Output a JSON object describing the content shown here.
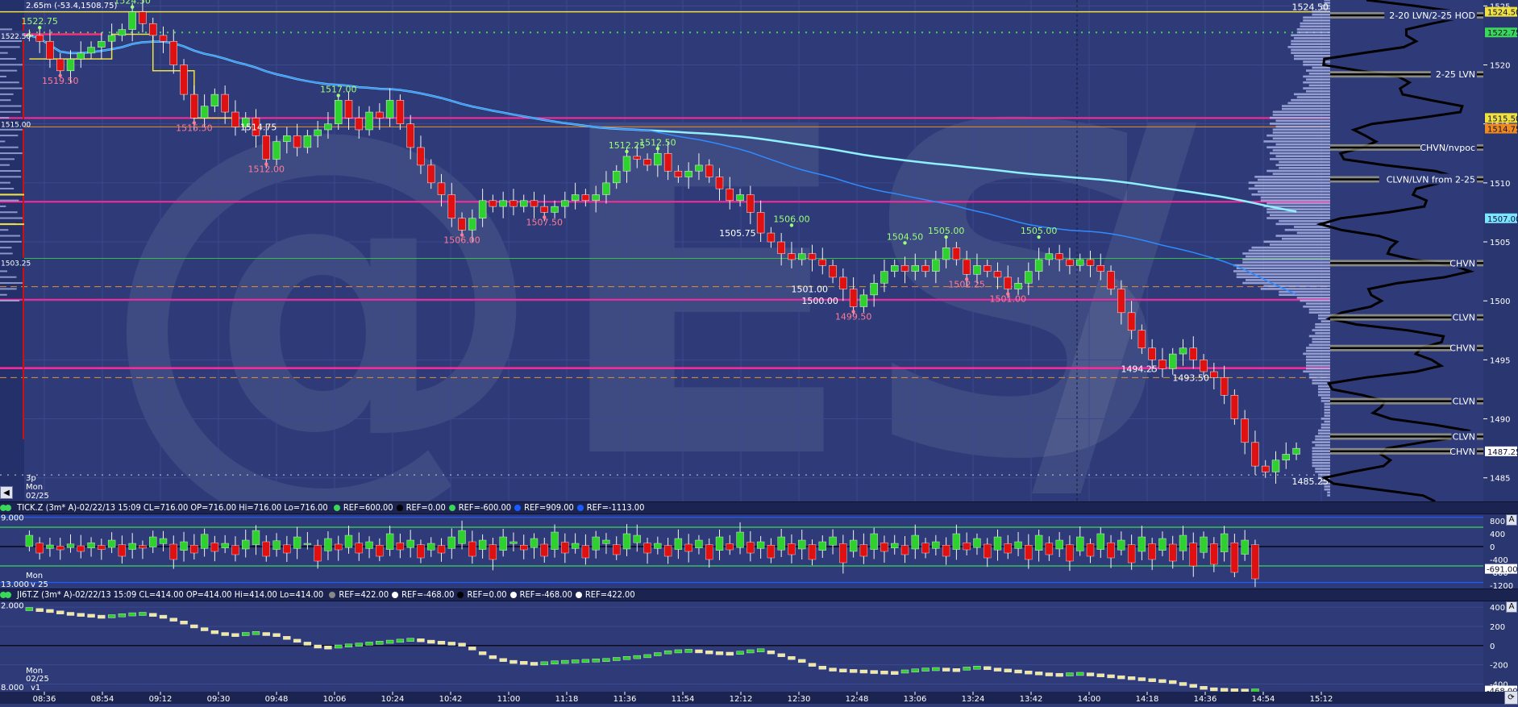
{
  "chart_data": [
    {
      "type": "candlestick",
      "symbol_watermark": "@ES",
      "header_text": "2.65m (-53.4,1508.75)",
      "ylim": [
        1483,
        1525.5
      ],
      "y_ticks": [
        "1525",
        "1520",
        "1515",
        "1510",
        "1505",
        "1500",
        "1495",
        "1490",
        "1485"
      ],
      "x_ticks": [
        "08:36",
        "08:54",
        "09:12",
        "09:30",
        "09:48",
        "10:06",
        "10:24",
        "10:42",
        "11:00",
        "11:18",
        "11:36",
        "11:54",
        "12:12",
        "12:30",
        "12:48",
        "13:06",
        "13:24",
        "13:42",
        "14:00",
        "14:18",
        "14:36",
        "14:54",
        "15:12"
      ],
      "session_labels": [
        "3p",
        "Mon",
        "02/25"
      ],
      "left_labels": [
        "1522.50",
        "1515.00",
        "1503.25"
      ],
      "closes_path": [
        1522.5,
        1522,
        1520.5,
        1519.5,
        1520.5,
        1521,
        1521.5,
        1522,
        1522.5,
        1523,
        1524.5,
        1523.5,
        1522.5,
        1522,
        1520,
        1517.5,
        1515.5,
        1516.5,
        1517.5,
        1516,
        1514.75,
        1515.5,
        1514,
        1512,
        1513.5,
        1514,
        1513,
        1514,
        1514.5,
        1515,
        1517,
        1515.5,
        1514.5,
        1516,
        1515.5,
        1517,
        1515,
        1513,
        1511.5,
        1510,
        1509,
        1507,
        1506,
        1507,
        1508.5,
        1508,
        1508.5,
        1508,
        1508.5,
        1508,
        1507.5,
        1508,
        1508.5,
        1509,
        1508.5,
        1509,
        1510,
        1511,
        1512.25,
        1512,
        1511.5,
        1512.5,
        1511,
        1510.5,
        1511,
        1511.5,
        1510.5,
        1509.5,
        1508.5,
        1509,
        1507.5,
        1505.75,
        1505,
        1504,
        1503.5,
        1504,
        1503.5,
        1503,
        1502,
        1501,
        1499.5,
        1500.5,
        1501.5,
        1502.5,
        1503,
        1502.5,
        1503,
        1502.5,
        1503.5,
        1504.5,
        1503.5,
        1502.25,
        1503,
        1502.5,
        1502,
        1501,
        1501.5,
        1502.5,
        1503.5,
        1504,
        1503.5,
        1503,
        1503.5,
        1503,
        1502.5,
        1501,
        1499,
        1497.5,
        1496,
        1495,
        1494.25,
        1495.5,
        1496,
        1495,
        1494,
        1493.5,
        1492,
        1490,
        1488,
        1486,
        1485.5,
        1486.5,
        1487,
        1487.5
      ],
      "price_labels": [
        {
          "text": "1522.75",
          "i": 1,
          "price": 1522.75,
          "pos": "above",
          "kind": "high"
        },
        {
          "text": "1524.50",
          "i": 10,
          "price": 1524.5,
          "pos": "above",
          "kind": "high"
        },
        {
          "text": "1519.50",
          "i": 3,
          "price": 1519.5,
          "pos": "below",
          "kind": "low"
        },
        {
          "text": "1515.50",
          "i": 16,
          "price": 1515.5,
          "pos": "below",
          "kind": "low"
        },
        {
          "text": "1514.75",
          "i": 20,
          "price": 1514.75,
          "pos": "right",
          "kind": "level"
        },
        {
          "text": "1517.00",
          "i": 30,
          "price": 1517.0,
          "pos": "above",
          "kind": "high"
        },
        {
          "text": "1512.00",
          "i": 23,
          "price": 1512.0,
          "pos": "below",
          "kind": "low"
        },
        {
          "text": "1506.00",
          "i": 42,
          "price": 1506.0,
          "pos": "below",
          "kind": "low"
        },
        {
          "text": "1507.50",
          "i": 50,
          "price": 1507.5,
          "pos": "below",
          "kind": "low"
        },
        {
          "text": "1512.25",
          "i": 58,
          "price": 1512.25,
          "pos": "above",
          "kind": "high"
        },
        {
          "text": "1512.50",
          "i": 61,
          "price": 1512.5,
          "pos": "above",
          "kind": "high"
        },
        {
          "text": "1505.75",
          "i": 71,
          "price": 1505.75,
          "pos": "left",
          "kind": "level"
        },
        {
          "text": "1506.00",
          "i": 74,
          "price": 1506.0,
          "pos": "above",
          "kind": "high"
        },
        {
          "text": "1501.00",
          "i": 78,
          "price": 1501.0,
          "pos": "left",
          "kind": "level"
        },
        {
          "text": "1500.00",
          "i": 79,
          "price": 1500.0,
          "pos": "left",
          "kind": "level"
        },
        {
          "text": "1499.50",
          "i": 80,
          "price": 1499.5,
          "pos": "below",
          "kind": "low"
        },
        {
          "text": "1504.50",
          "i": 85,
          "price": 1504.5,
          "pos": "above",
          "kind": "high"
        },
        {
          "text": "1505.00",
          "i": 89,
          "price": 1505.0,
          "pos": "above",
          "kind": "high"
        },
        {
          "text": "1502.25",
          "i": 91,
          "price": 1502.25,
          "pos": "below",
          "kind": "low"
        },
        {
          "text": "1505.00",
          "i": 98,
          "price": 1505.0,
          "pos": "above",
          "kind": "high"
        },
        {
          "text": "1501.00",
          "i": 95,
          "price": 1501.0,
          "pos": "below",
          "kind": "low"
        },
        {
          "text": "1494.25",
          "i": 110,
          "price": 1494.25,
          "pos": "left",
          "kind": "level"
        },
        {
          "text": "1493.50",
          "i": 115,
          "price": 1493.5,
          "pos": "left",
          "kind": "level"
        },
        {
          "text": "1524.50",
          "i": 122,
          "price": 1524.5,
          "pos": "profile-top",
          "kind": "level"
        },
        {
          "text": "1485.25",
          "i": 122,
          "price": 1485.25,
          "pos": "profile-bottom",
          "kind": "level"
        }
      ],
      "horizontal_levels": [
        {
          "price": 1524.5,
          "color": "#f0e040",
          "style": "solid",
          "width": 1.5
        },
        {
          "price": 1522.75,
          "color": "#3bd65a",
          "style": "dotted",
          "width": 2
        },
        {
          "price": 1522.6,
          "color": "#ff2a7a",
          "style": "solid",
          "width": 2.5,
          "x_end_frac": 0.06
        },
        {
          "price": 1515.5,
          "color": "#ff2a9a",
          "style": "solid",
          "width": 2
        },
        {
          "price": 1514.75,
          "color": "#f08a20",
          "style": "solid",
          "width": 1
        },
        {
          "price": 1508.4,
          "color": "#ff2a9a",
          "style": "solid",
          "width": 2
        },
        {
          "price": 1503.6,
          "color": "#30c040",
          "style": "solid",
          "width": 1
        },
        {
          "price": 1501.2,
          "color": "#e09030",
          "style": "dashed",
          "width": 1
        },
        {
          "price": 1500.1,
          "color": "#ff2a9a",
          "style": "solid",
          "width": 2
        },
        {
          "price": 1494.3,
          "color": "#ff2a9a",
          "style": "solid",
          "width": 2.5
        },
        {
          "price": 1493.5,
          "color": "#e09030",
          "style": "dashed",
          "width": 1
        },
        {
          "price": 1485.25,
          "color": "#c9cde0",
          "style": "dotted",
          "width": 1
        }
      ],
      "volume_profile_levels": [
        {
          "text": "2-20 LVN/2-25 HOD",
          "price": 1524.2
        },
        {
          "text": "2-25 LVN",
          "price": 1519.2
        },
        {
          "text": "CHVN/nvpoc",
          "price": 1513.0
        },
        {
          "text": "CLVN/LVN from 2-25",
          "price": 1510.3
        },
        {
          "text": "CHVN",
          "price": 1503.2
        },
        {
          "text": "CLVN",
          "price": 1498.6
        },
        {
          "text": "CHVN",
          "price": 1496.0
        },
        {
          "text": "CLVN",
          "price": 1491.5
        },
        {
          "text": "CLVN",
          "price": 1488.5
        },
        {
          "text": "CHVN",
          "price": 1487.25
        }
      ],
      "right_axis_tags": [
        {
          "text": "1524.50",
          "price": 1524.5,
          "color": "#f0e040"
        },
        {
          "text": "1522.75",
          "price": 1522.75,
          "color": "#3bd65a"
        },
        {
          "text": "1515.50",
          "price": 1515.5,
          "color": "#f0e040"
        },
        {
          "text": "1514.75",
          "price": 1514.6,
          "color": "#f08a20"
        },
        {
          "text": "1507.00",
          "price": 1507.0,
          "color": "#7be4ff"
        },
        {
          "text": "1487.25",
          "price": 1487.25,
          "color": "#ffffff"
        }
      ]
    },
    {
      "type": "bar-oscillator",
      "header": {
        "title": "TICK.Z (3m* A)-02/22/13 15:09 CL=716.00 OP=716.00 Hi=716.00 Lo=716.00",
        "refs": [
          {
            "text": "REF=600.00",
            "color": "#3bd65a"
          },
          {
            "text": "REF=0.00",
            "color": "#000000"
          },
          {
            "text": "REF=-600.00",
            "color": "#3bd65a"
          },
          {
            "text": "REF=909.00",
            "color": "#1a5cff"
          },
          {
            "text": "REF=-1113.00",
            "color": "#1a5cff"
          }
        ]
      },
      "ylim": [
        -1300,
        1000
      ],
      "y_ticks": [
        "800",
        "400",
        "0",
        "-400",
        "-800",
        "-1200"
      ],
      "ref_levels": [
        909,
        600,
        0,
        -600,
        -1113
      ],
      "left_labels": [
        "9.000",
        "13.000",
        "Mon",
        "v 25"
      ],
      "last_value": "-691.00",
      "values": [
        350,
        -200,
        50,
        -100,
        80,
        -150,
        120,
        -90,
        200,
        -300,
        100,
        -50,
        300,
        250,
        -400,
        150,
        -200,
        380,
        -150,
        100,
        -250,
        200,
        500,
        -300,
        180,
        -200,
        300,
        100,
        -450,
        250,
        -100,
        350,
        -200,
        150,
        -300,
        400,
        -100,
        200,
        -350,
        100,
        -200,
        300,
        500,
        -300,
        200,
        -400,
        300,
        150,
        -100,
        250,
        -300,
        450,
        -200,
        100,
        -350,
        300,
        200,
        -250,
        400,
        350,
        -200,
        100,
        -300,
        250,
        -150,
        200,
        -400,
        300,
        -100,
        450,
        -200,
        150,
        -350,
        300,
        -250,
        200,
        -400,
        150,
        300,
        -500,
        200,
        -300,
        400,
        -150,
        100,
        -250,
        350,
        -200,
        150,
        -300,
        400,
        -100,
        250,
        -350,
        300,
        -200,
        150,
        -400,
        350,
        -250,
        200,
        -450,
        300,
        -300,
        400,
        -350,
        200,
        -500,
        300,
        -400,
        250,
        -450,
        350,
        -600,
        300,
        -550,
        400,
        -800,
        200,
        -1000
      ]
    },
    {
      "type": "line-oscillator",
      "header": {
        "title": "JI6T.Z (3m* A)-02/22/13 15:09 CL=414.00 OP=414.00 Hi=414.00 Lo=414.00",
        "refs": [
          {
            "text": "REF=422.00",
            "color": "#888888"
          },
          {
            "text": "REF=-468.00",
            "color": "#ffffff"
          },
          {
            "text": "REF=0.00",
            "color": "#000000"
          },
          {
            "text": "REF=-468.00",
            "color": "#ffffff"
          },
          {
            "text": "REF=422.00",
            "color": "#ffffff"
          }
        ]
      },
      "ylim": [
        -480,
        460
      ],
      "y_ticks": [
        "400",
        "200",
        "0",
        "-200",
        "-400"
      ],
      "ref_levels": [
        422,
        0,
        -468
      ],
      "left_labels": [
        "2.000",
        "Mon",
        "02/25",
        "8.000",
        "v1"
      ],
      "last_value": "-468.00",
      "values": [
        380,
        370,
        360,
        345,
        330,
        320,
        310,
        300,
        305,
        315,
        325,
        330,
        320,
        300,
        270,
        240,
        200,
        170,
        140,
        120,
        110,
        120,
        130,
        120,
        110,
        80,
        50,
        20,
        -10,
        -20,
        -10,
        0,
        10,
        20,
        30,
        40,
        50,
        60,
        55,
        40,
        30,
        20,
        10,
        -30,
        -80,
        -120,
        -150,
        -170,
        -180,
        -190,
        -185,
        -175,
        -170,
        -165,
        -160,
        -155,
        -150,
        -140,
        -130,
        -120,
        -110,
        -90,
        -70,
        -60,
        -55,
        -60,
        -70,
        -80,
        -85,
        -75,
        -60,
        -50,
        -70,
        -100,
        -130,
        -160,
        -200,
        -230,
        -250,
        -260,
        -265,
        -270,
        -275,
        -280,
        -285,
        -270,
        -260,
        -250,
        -245,
        -250,
        -255,
        -240,
        -230,
        -235,
        -250,
        -260,
        -270,
        -280,
        -290,
        -300,
        -305,
        -300,
        -295,
        -300,
        -310,
        -320,
        -330,
        -340,
        -350,
        -360,
        -370,
        -380,
        -400,
        -420,
        -440,
        -455,
        -460,
        -465,
        -468,
        -468
      ]
    }
  ],
  "time_axis_corner": "A"
}
